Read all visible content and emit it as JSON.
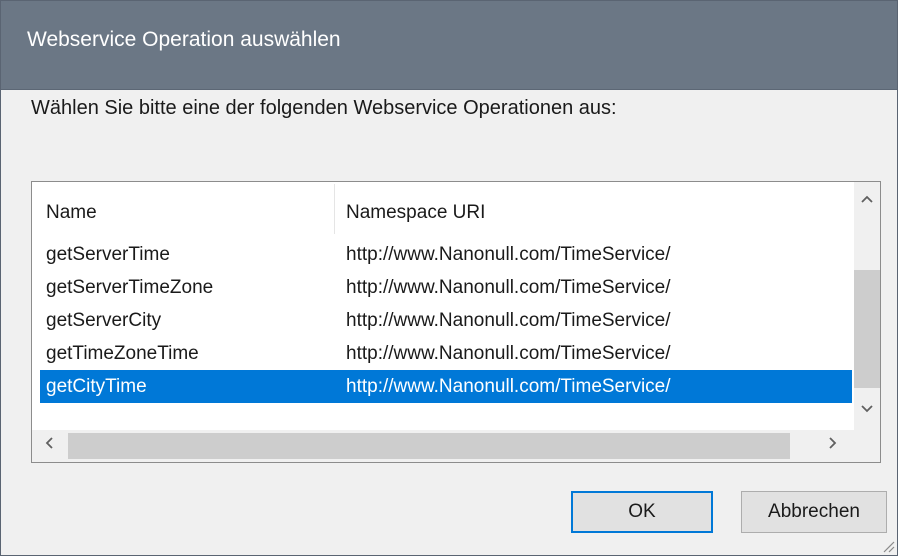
{
  "window": {
    "title": "Webservice Operation auswählen"
  },
  "prompt": "Wählen Sie bitte eine der folgenden Webservice Operationen aus:",
  "list": {
    "columns": [
      "Name",
      "Namespace URI"
    ],
    "rows": [
      {
        "name": "getServerTime",
        "namespace": "http://www.Nanonull.com/TimeService/"
      },
      {
        "name": "getServerTimeZone",
        "namespace": "http://www.Nanonull.com/TimeService/"
      },
      {
        "name": "getServerCity",
        "namespace": "http://www.Nanonull.com/TimeService/"
      },
      {
        "name": "getTimeZoneTime",
        "namespace": "http://www.Nanonull.com/TimeService/"
      },
      {
        "name": "getCityTime",
        "namespace": "http://www.Nanonull.com/TimeService/"
      }
    ],
    "selected_index": 4,
    "selection_color": "#0078d7"
  },
  "icons": {
    "scroll_up": "chevron-up-icon",
    "scroll_down": "chevron-down-icon",
    "scroll_left": "chevron-left-icon",
    "scroll_right": "chevron-right-icon",
    "resize_grip": "resize-grip-icon"
  },
  "buttons": {
    "ok_label": "OK",
    "cancel_label": "Abbrechen"
  },
  "colors": {
    "titlebar": "#6b7785",
    "accent": "#0078d7"
  }
}
